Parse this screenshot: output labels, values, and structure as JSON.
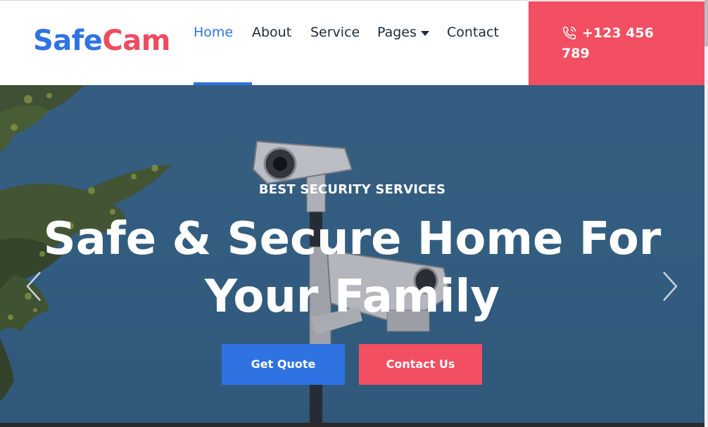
{
  "brand": {
    "part1": "Safe",
    "part2": "Cam",
    "colors": {
      "primary": "#2f73e2",
      "accent": "#ef4b5f"
    }
  },
  "nav": {
    "items": [
      {
        "label": "Home",
        "active": true
      },
      {
        "label": "About"
      },
      {
        "label": "Service"
      },
      {
        "label": "Pages",
        "has_dropdown": true
      },
      {
        "label": "Contact"
      }
    ]
  },
  "contact": {
    "phone_line1": "+123 456",
    "phone_line2": "789",
    "icon": "phone-icon"
  },
  "hero": {
    "eyebrow": "BEST SECURITY SERVICES",
    "headline_line1": "Safe & Secure Home For",
    "headline_line2": "Your Family",
    "primary_button": "Get Quote",
    "secondary_button": "Contact Us",
    "prev_icon": "chevron-left-icon",
    "next_icon": "chevron-right-icon"
  }
}
